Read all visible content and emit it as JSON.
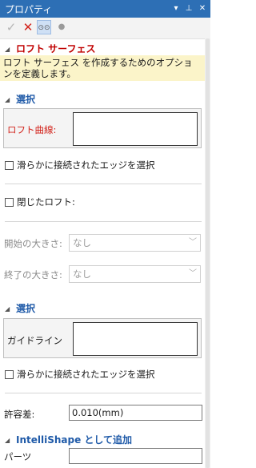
{
  "window": {
    "title": "プロパティ"
  },
  "toolbar": {
    "ok": "✓",
    "cancel": "✕",
    "preview": "⊙⊙",
    "dot": "●"
  },
  "loft": {
    "header": "ロフト サーフェス",
    "description": "ロフト サーフェス を作成するためのオプションを定義します。"
  },
  "selection1": {
    "header": "選択",
    "list_label": "ロフト曲線:",
    "checkbox_label": "滑らかに接続されたエッジを選択"
  },
  "closed_loft": {
    "label": "閉じたロフト:"
  },
  "start_size": {
    "label": "開始の大きさ:",
    "value": "なし"
  },
  "end_size": {
    "label": "終了の大きさ:",
    "value": "なし"
  },
  "selection2": {
    "header": "選択",
    "list_label": "ガイドライン",
    "checkbox_label": "滑らかに接続されたエッジを選択"
  },
  "tolerance": {
    "label": "許容差:",
    "value": "0.010(mm)"
  },
  "intellishape": {
    "header": "IntelliShape として追加",
    "part_label": "パーツ",
    "part_value": ""
  },
  "colors": {
    "title_bar": "#2d6fb5",
    "loft_header": "#c00000",
    "section_header": "#1f5aa8",
    "description_bg": "#fbf4c9"
  }
}
